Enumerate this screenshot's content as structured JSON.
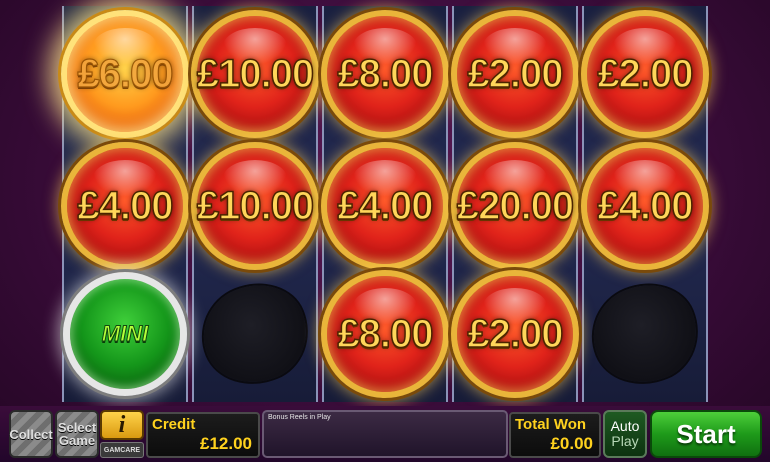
{
  "reels": {
    "columns": [
      {
        "cells": [
          {
            "type": "coin",
            "value": "£6.00",
            "highlighted": true
          },
          {
            "type": "coin",
            "value": "£4.00"
          },
          {
            "type": "mini",
            "label": "MINI"
          }
        ]
      },
      {
        "cells": [
          {
            "type": "coin",
            "value": "£10.00"
          },
          {
            "type": "coin",
            "value": "£10.00"
          },
          {
            "type": "blank"
          }
        ]
      },
      {
        "cells": [
          {
            "type": "coin",
            "value": "£8.00"
          },
          {
            "type": "coin",
            "value": "£4.00"
          },
          {
            "type": "coin",
            "value": "£8.00"
          }
        ]
      },
      {
        "cells": [
          {
            "type": "coin",
            "value": "£2.00"
          },
          {
            "type": "coin",
            "value": "£20.00"
          },
          {
            "type": "coin",
            "value": "£2.00"
          }
        ]
      },
      {
        "cells": [
          {
            "type": "coin",
            "value": "£2.00"
          },
          {
            "type": "coin",
            "value": "£4.00"
          },
          {
            "type": "blank"
          }
        ]
      }
    ]
  },
  "controls": {
    "collect_label": "Collect",
    "select_game_label": "Select Game",
    "info_label": "i",
    "gamcare_label": "GAMCARE",
    "credit_label": "Credit",
    "credit_value": "£12.00",
    "message": "Bonus Reels in Play",
    "total_won_label": "Total Won",
    "total_won_value": "£0.00",
    "auto_label_1": "Auto",
    "auto_label_2": "Play",
    "start_label": "Start"
  },
  "colors": {
    "coin_gold": "#ffd65a",
    "start_green": "#1e9a1a",
    "panel_text": "#ffd21e"
  }
}
